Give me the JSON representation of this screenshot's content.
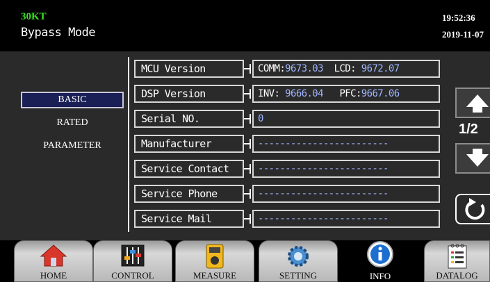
{
  "header": {
    "model": "30KT",
    "mode": "Bypass Mode",
    "time": "19:52:36",
    "date": "2019-11-07"
  },
  "sidebar": {
    "items": [
      {
        "label": "BASIC",
        "active": true
      },
      {
        "label": "RATED",
        "active": false
      },
      {
        "label": "PARAMETER",
        "active": false
      }
    ]
  },
  "info": {
    "rows": [
      {
        "label": "MCU Version",
        "value_parts": [
          {
            "text": "COMM:",
            "kind": "key"
          },
          {
            "text": "9673.03",
            "kind": "num"
          },
          {
            "text": "  LCD:",
            "kind": "key"
          },
          {
            "text": " 9672.07",
            "kind": "num"
          }
        ]
      },
      {
        "label": "DSP Version",
        "value_parts": [
          {
            "text": "INV:",
            "kind": "key"
          },
          {
            "text": " 9666.04",
            "kind": "num"
          },
          {
            "text": "   PFC:",
            "kind": "key"
          },
          {
            "text": "9667.06",
            "kind": "num"
          }
        ]
      },
      {
        "label": "Serial NO.",
        "value_parts": [
          {
            "text": "0",
            "kind": "num"
          }
        ]
      },
      {
        "label": "Manufacturer",
        "value_parts": [
          {
            "text": "------------------------",
            "kind": "num"
          }
        ]
      },
      {
        "label": "Service Contact",
        "value_parts": [
          {
            "text": "------------------------",
            "kind": "num"
          }
        ]
      },
      {
        "label": "Service Phone",
        "value_parts": [
          {
            "text": "------------------------",
            "kind": "num"
          }
        ]
      },
      {
        "label": "Service Mail",
        "value_parts": [
          {
            "text": "------------------------",
            "kind": "num"
          }
        ]
      }
    ]
  },
  "pager": {
    "indicator": "1/2",
    "up_icon": "arrow-up-icon",
    "down_icon": "arrow-down-icon",
    "back_icon": "refresh-icon"
  },
  "tabs": [
    {
      "label": "HOME",
      "icon": "home-icon",
      "active": false
    },
    {
      "label": "CONTROL",
      "icon": "control-sliders-icon",
      "active": false
    },
    {
      "label": "MEASURE",
      "icon": "multimeter-icon",
      "active": false
    },
    {
      "label": "SETTING",
      "icon": "gear-icon",
      "active": false
    },
    {
      "label": "INFO",
      "icon": "info-icon",
      "active": true
    },
    {
      "label": "DATALOG",
      "icon": "log-book-icon",
      "active": false
    }
  ],
  "colors": {
    "model": "#36e51e",
    "value_text": "#9fb6ff",
    "active_nav_bg": "#1a1f55",
    "panel_bg": "#2a2a2a"
  }
}
